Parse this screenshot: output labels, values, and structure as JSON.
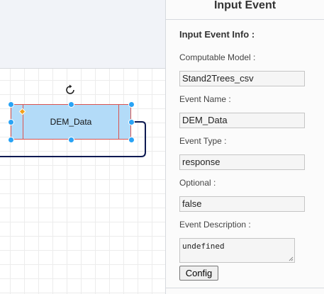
{
  "canvas": {
    "node": {
      "label": "DEM_Data"
    },
    "rotate_handle_icon": "rotate-icon"
  },
  "panel": {
    "title": "Input Event",
    "section_title": "Input Event Info :",
    "fields": {
      "computable_model": {
        "label": "Computable Model :",
        "value": "Stand2Trees_csv"
      },
      "event_name": {
        "label": "Event Name :",
        "value": "DEM_Data"
      },
      "event_type": {
        "label": "Event Type :",
        "value": "response"
      },
      "optional": {
        "label": "Optional :",
        "value": "false"
      },
      "event_description": {
        "label": "Event Description :",
        "value": "undefined"
      }
    },
    "config_button": "Config"
  },
  "colors": {
    "node_fill": "#b3dbf8",
    "node_border": "#d9534f",
    "handle": "#29a3f5",
    "diamond_handle": "#f3a019",
    "connector": "#0d1a52"
  }
}
